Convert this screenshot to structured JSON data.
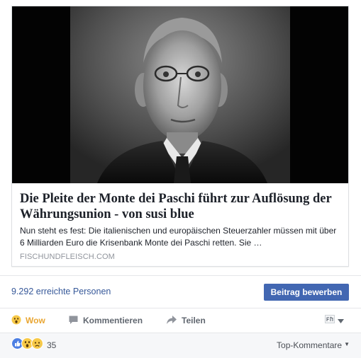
{
  "link_card": {
    "headline_line1": "Die Pleite der Monte dei Paschi führt zur Auflösung der",
    "headline_line2": "Währungsunion - von susi blue",
    "description_line1": "Nun steht es fest: Die italienischen und europäischen Steuerzahler müssen mit über",
    "description_line2": "6 Milliarden Euro die Krisenbank Monte dei Paschi retten. Sie …",
    "domain": "FISCHUNDFLEISCH.COM"
  },
  "insights": {
    "reach_text": "9.292 erreichte Personen",
    "promote_label": "Beitrag bewerben"
  },
  "actions": {
    "wow_label": "Wow",
    "comment_label": "Kommentieren",
    "share_label": "Teilen"
  },
  "reactions": {
    "count": "35",
    "icons": [
      "like-icon",
      "wow-icon",
      "sad-icon"
    ]
  },
  "comments_sort": {
    "label": "Top-Kommentare"
  },
  "colors": {
    "link_blue": "#365899",
    "button_blue": "#4267b2",
    "wow_yellow": "#e9a633",
    "muted_text": "#616770"
  }
}
